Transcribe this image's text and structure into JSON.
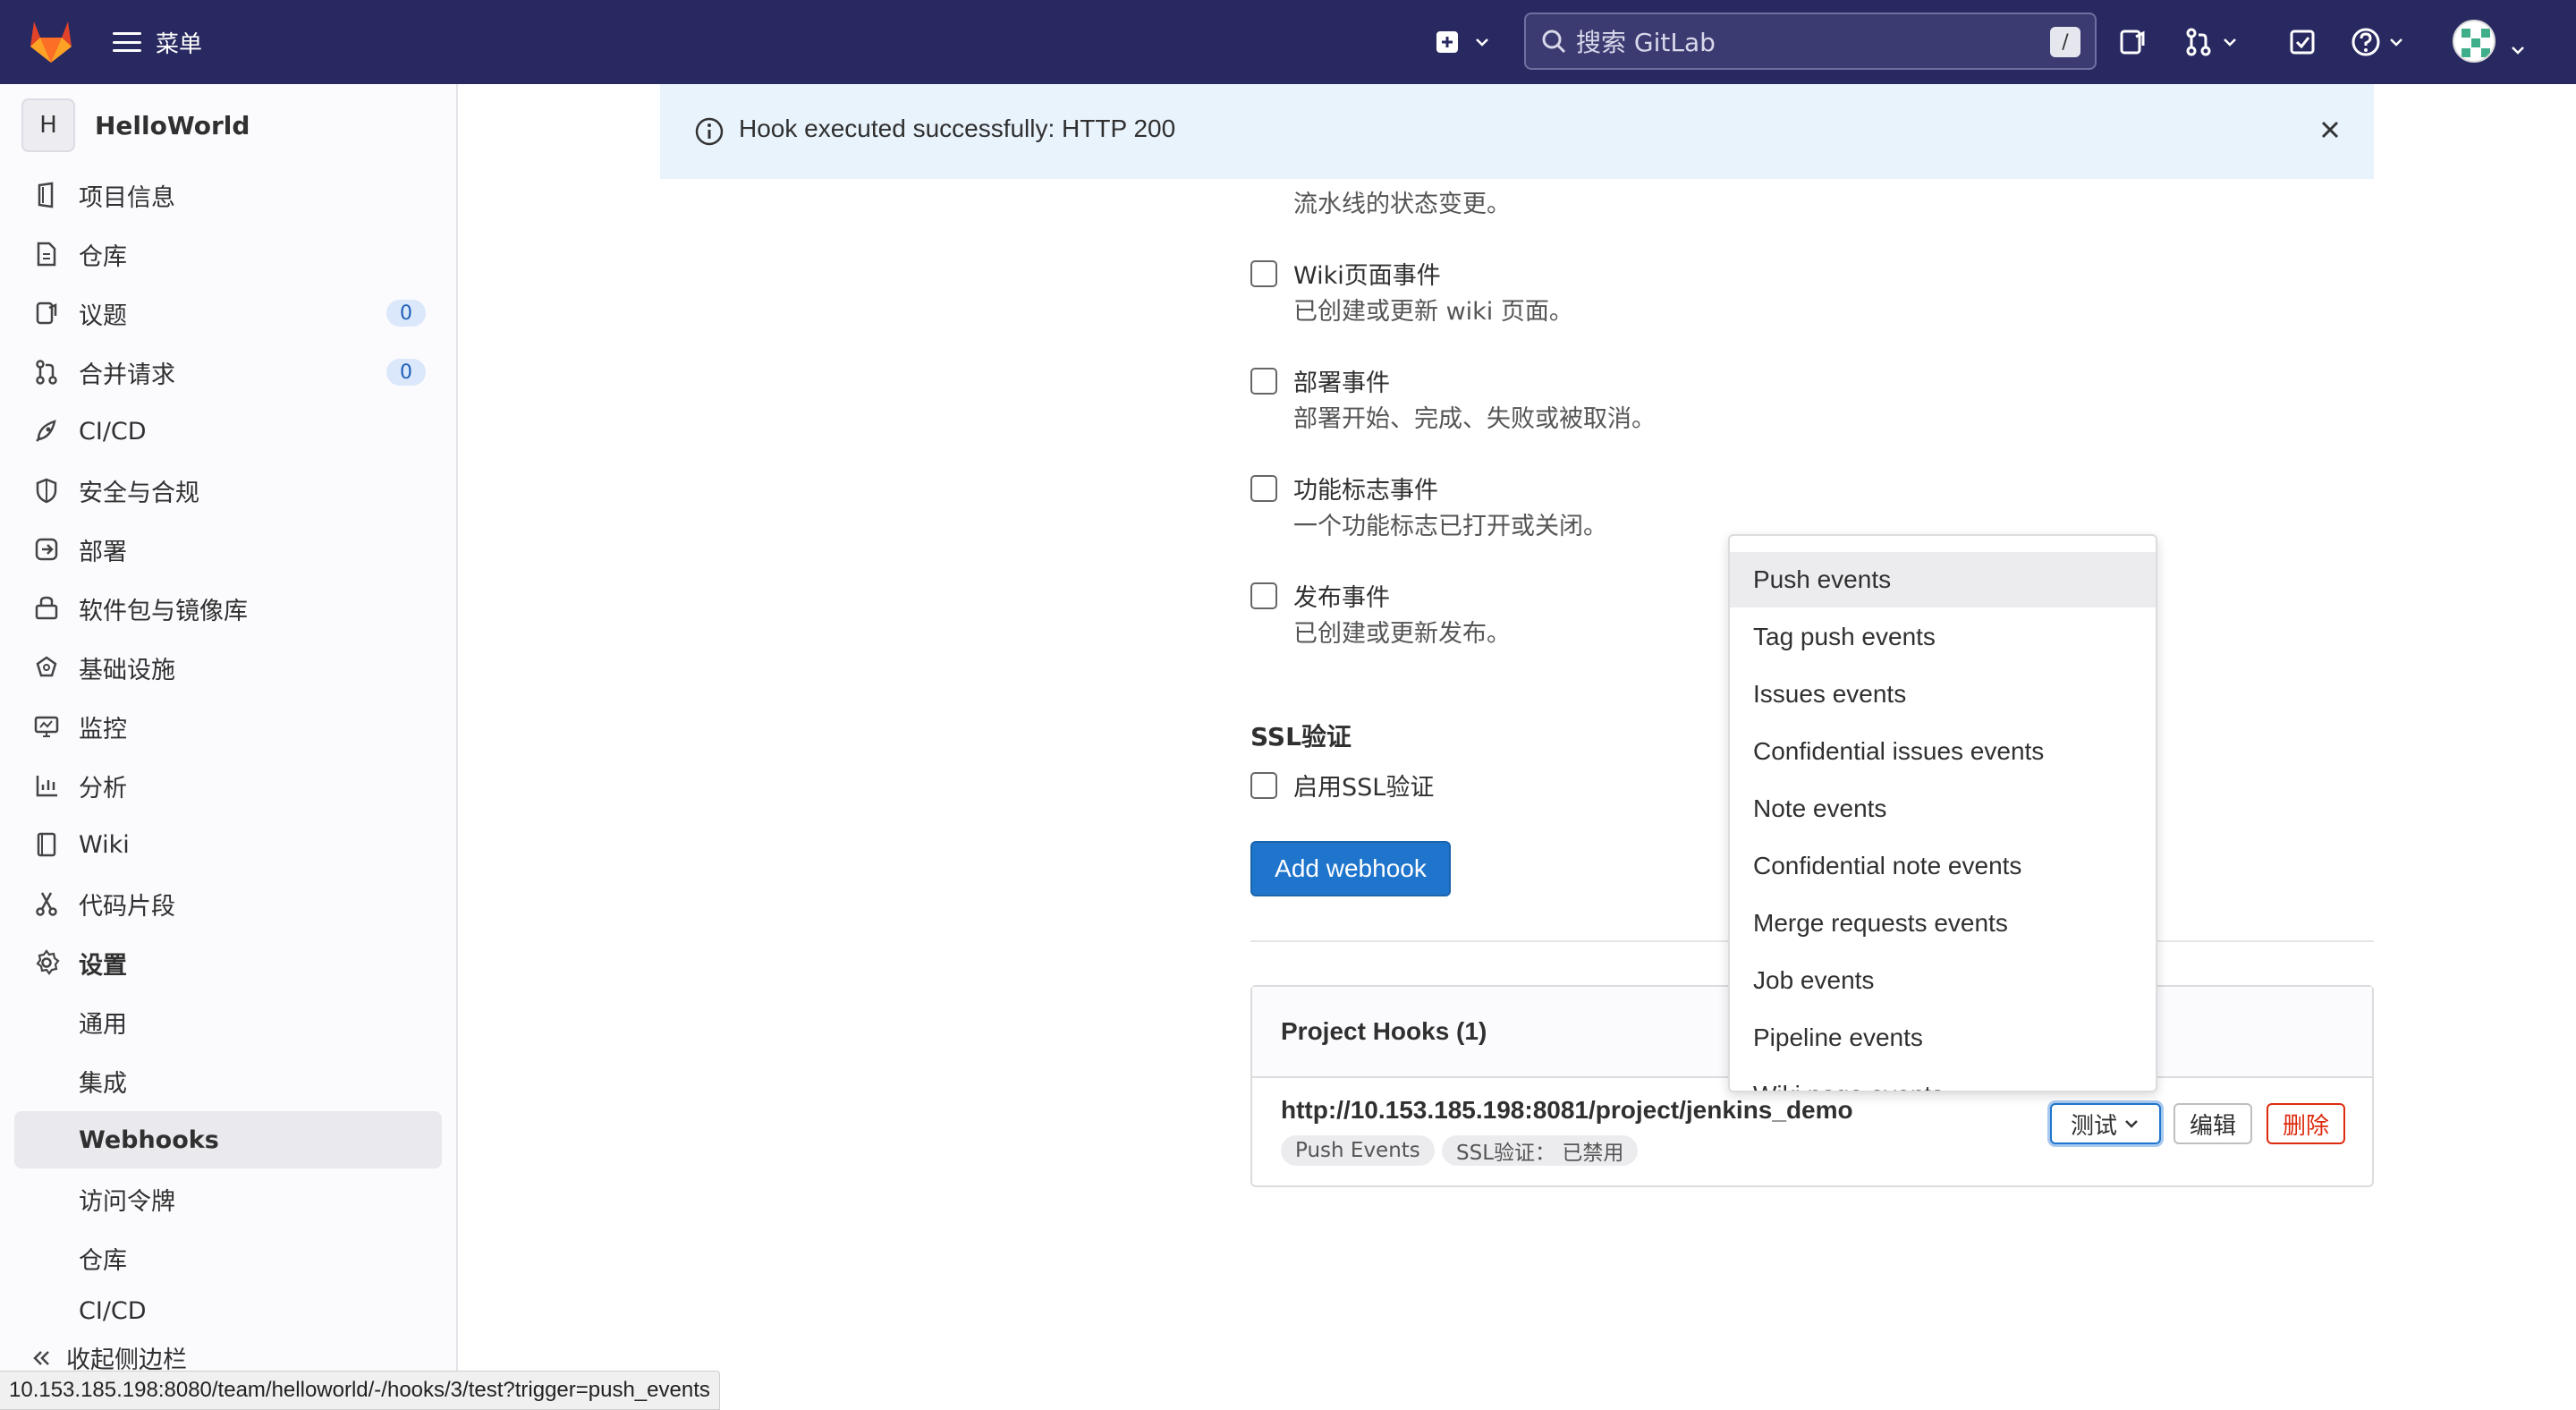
{
  "topbar": {
    "menu_label": "菜单",
    "search_placeholder": "搜索 GitLab",
    "search_shortcut": "/"
  },
  "sidebar": {
    "project_initial": "H",
    "project_name": "HelloWorld",
    "items": [
      {
        "label": "项目信息",
        "icon": "project-info-icon"
      },
      {
        "label": "仓库",
        "icon": "repository-icon"
      },
      {
        "label": "议题",
        "icon": "issues-icon",
        "badge": "0"
      },
      {
        "label": "合并请求",
        "icon": "merge-request-icon",
        "badge": "0"
      },
      {
        "label": "CI/CD",
        "icon": "rocket-icon"
      },
      {
        "label": "安全与合规",
        "icon": "shield-icon"
      },
      {
        "label": "部署",
        "icon": "deploy-icon"
      },
      {
        "label": "软件包与镜像库",
        "icon": "package-icon"
      },
      {
        "label": "基础设施",
        "icon": "cloud-icon"
      },
      {
        "label": "监控",
        "icon": "monitor-icon"
      },
      {
        "label": "分析",
        "icon": "chart-icon"
      },
      {
        "label": "Wiki",
        "icon": "book-icon"
      },
      {
        "label": "代码片段",
        "icon": "snippet-icon"
      },
      {
        "label": "设置",
        "icon": "gear-icon"
      }
    ],
    "settings_sub": [
      "通用",
      "集成",
      "Webhooks",
      "访问令牌",
      "仓库",
      "CI/CD"
    ],
    "active_sub": "Webhooks",
    "collapse_label": "收起侧边栏"
  },
  "alert": {
    "message": "Hook executed successfully: HTTP 200"
  },
  "form": {
    "pipeline_desc": "流水线的状态变更。",
    "events": [
      {
        "label": "Wiki页面事件",
        "desc": "已创建或更新 wiki 页面。",
        "checked": false
      },
      {
        "label": "部署事件",
        "desc": "部署开始、完成、失败或被取消。",
        "checked": false
      },
      {
        "label": "功能标志事件",
        "desc": "一个功能标志已打开或关闭。",
        "checked": false
      },
      {
        "label": "发布事件",
        "desc": "已创建或更新发布。",
        "checked": false
      }
    ],
    "ssl_title": "SSL验证",
    "ssl_label": "启用SSL验证",
    "add_button": "Add webhook"
  },
  "hooks": {
    "title": "Project Hooks (1)",
    "url": "http://10.153.185.198:8081/project/jenkins_demo",
    "tags": [
      "Push Events",
      "SSL验证：  已禁用"
    ],
    "test_button": "测试",
    "edit_button": "编辑",
    "delete_button": "删除"
  },
  "dropdown": {
    "items": [
      "Push events",
      "Tag push events",
      "Issues events",
      "Confidential issues events",
      "Note events",
      "Confidential note events",
      "Merge requests events",
      "Job events",
      "Pipeline events",
      "Wiki page events"
    ],
    "highlighted": "Push events"
  },
  "statusbar": {
    "url": "10.153.185.198:8080/team/helloworld/-/hooks/3/test?trigger=push_events"
  },
  "colors": {
    "topbar": "#292961",
    "primary": "#1f75cb",
    "danger": "#dd2b0e",
    "alert_bg": "#e9f3fc"
  }
}
